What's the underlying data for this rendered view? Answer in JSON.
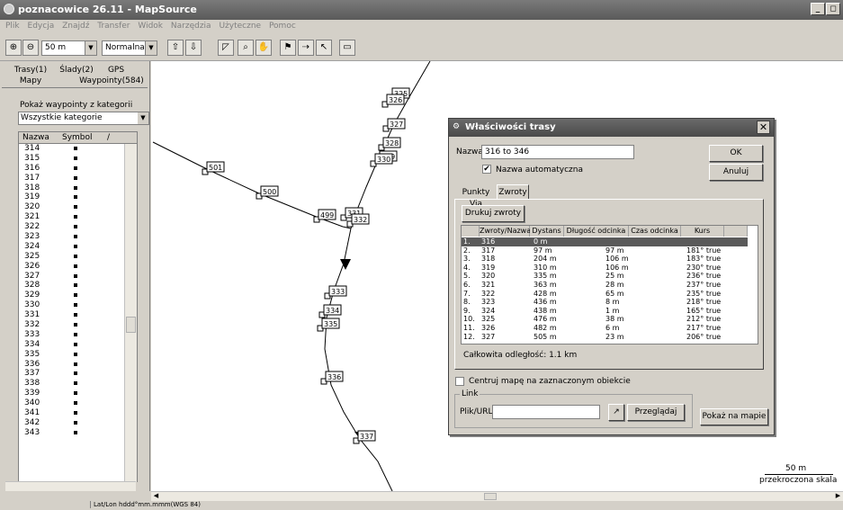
{
  "window": {
    "title": "poznacowice 26.11 - MapSource",
    "minimize": "_",
    "restore": "◻"
  },
  "menu": [
    "Plik",
    "Edycja",
    "Znajdź",
    "Transfer",
    "Widok",
    "Narzędzia",
    "Użyteczne",
    "Pomoc"
  ],
  "toolbar": {
    "zoom_value": "50 m",
    "detail_value": "Normalna"
  },
  "left_panel": {
    "tabs": {
      "routes": "Trasy(1)",
      "tracks": "Ślady(2)",
      "gps": "GPS",
      "maps": "Mapy",
      "waypoints": "Waypointy(584)"
    },
    "category_label": "Pokaż waypointy z kategorii",
    "category_value": "Wszystkie kategorie",
    "list_header": {
      "name": "Nazwa",
      "symbol": "Symbol",
      "sort": "/"
    },
    "waypoints": [
      "314",
      "315",
      "316",
      "317",
      "318",
      "319",
      "320",
      "321",
      "322",
      "323",
      "324",
      "325",
      "326",
      "327",
      "328",
      "329",
      "330",
      "331",
      "332",
      "333",
      "334",
      "335",
      "336",
      "337",
      "338",
      "339",
      "340",
      "341",
      "342",
      "343"
    ]
  },
  "map": {
    "waypoint_labels": [
      "501",
      "500",
      "499",
      "331",
      "332",
      "333",
      "334",
      "335",
      "336",
      "337",
      "325",
      "326",
      "327",
      "328",
      "329",
      "330"
    ],
    "scale_value": "50 m",
    "scale_note": "przekroczona skala"
  },
  "dialog": {
    "title": "Właściwości trasy",
    "name_label": "Nazwa",
    "name_value": "316 to 346",
    "auto_name_label": "Nazwa automatyczna",
    "auto_name_checked": "✔",
    "ok": "OK",
    "cancel": "Anuluj",
    "tabs": {
      "via": "Punkty Via",
      "turns": "Zwroty"
    },
    "print_turns": "Drukuj zwroty",
    "columns": {
      "name": "Zwroty/Nazwa",
      "dist": "Dystans",
      "leg_len": "Długość odcinka",
      "leg_time": "Czas odcinka",
      "course": "Kurs"
    },
    "rows": [
      {
        "n": "1.",
        "name": "316",
        "dist": "0 m",
        "leg": "",
        "course": ""
      },
      {
        "n": "2.",
        "name": "317",
        "dist": "97 m",
        "leg": "97 m",
        "course": "181° true"
      },
      {
        "n": "3.",
        "name": "318",
        "dist": "204 m",
        "leg": "106 m",
        "course": "183° true"
      },
      {
        "n": "4.",
        "name": "319",
        "dist": "310 m",
        "leg": "106 m",
        "course": "230° true"
      },
      {
        "n": "5.",
        "name": "320",
        "dist": "335 m",
        "leg": "25 m",
        "course": "236° true"
      },
      {
        "n": "6.",
        "name": "321",
        "dist": "363 m",
        "leg": "28 m",
        "course": "237° true"
      },
      {
        "n": "7.",
        "name": "322",
        "dist": "428 m",
        "leg": "65 m",
        "course": "235° true"
      },
      {
        "n": "8.",
        "name": "323",
        "dist": "436 m",
        "leg": "8 m",
        "course": "218° true"
      },
      {
        "n": "9.",
        "name": "324",
        "dist": "438 m",
        "leg": "1 m",
        "course": "165° true"
      },
      {
        "n": "10.",
        "name": "325",
        "dist": "476 m",
        "leg": "38 m",
        "course": "212° true"
      },
      {
        "n": "11.",
        "name": "326",
        "dist": "482 m",
        "leg": "6 m",
        "course": "217° true"
      },
      {
        "n": "12.",
        "name": "327",
        "dist": "505 m",
        "leg": "23 m",
        "course": "206° true"
      }
    ],
    "total_distance": "Całkowita odległość: 1.1 km",
    "center_map_label": "Centruj mapę na zaznaczonym obiekcie",
    "link_group": "Link",
    "file_url_label": "Plik/URL",
    "file_url_value": "",
    "browse": "Przeglądaj",
    "show_on_map": "Pokaż na mapie"
  },
  "status": {
    "coords": "Lat/Lon hddd°mm.mmm(WGS 84)"
  }
}
